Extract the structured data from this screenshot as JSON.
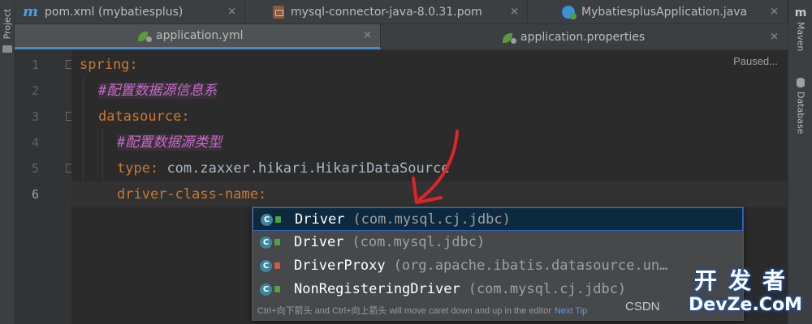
{
  "left_panel": {
    "label": "Project"
  },
  "right_panel": {
    "maven_icon": "m",
    "maven_label": "Maven",
    "database_label": "Database"
  },
  "tabs_top": [
    {
      "label": "pom.xml (mybatiesplus)",
      "icon": "m"
    },
    {
      "label": "mysql-connector-java-8.0.31.pom",
      "icon": "pom-file-icon"
    },
    {
      "label": "MybatiesplusApplication.java",
      "icon": "spring-app-icon"
    }
  ],
  "tabs_files": [
    {
      "label": "application.yml",
      "icon": "yaml-spring-icon"
    },
    {
      "label": "application.properties",
      "icon": "properties-spring-icon"
    }
  ],
  "close_glyph": "✕",
  "editor": {
    "status": "Paused...",
    "lines": [
      {
        "number": "1",
        "key": "spring",
        "colon": ":",
        "value": "",
        "comment": ""
      },
      {
        "number": "2",
        "key": "",
        "colon": "",
        "value": "",
        "comment": "#配置数据源信息系"
      },
      {
        "number": "3",
        "key": "datasource",
        "colon": ":",
        "value": "",
        "comment": ""
      },
      {
        "number": "4",
        "key": "",
        "colon": "",
        "value": "",
        "comment": "#配置数据源类型"
      },
      {
        "number": "5",
        "key": "type",
        "colon": ":",
        "value": " com.zaxxer.hikari.HikariDataSource",
        "comment": ""
      },
      {
        "number": "6",
        "key": "driver-class-name",
        "colon": ":",
        "value": "",
        "comment": ""
      }
    ]
  },
  "completion": {
    "items": [
      {
        "icon": "C",
        "name": "Driver",
        "package": "(com.mysql.cj.jdbc)",
        "visibility": "public"
      },
      {
        "icon": "C",
        "name": "Driver",
        "package": "(com.mysql.jdbc)",
        "visibility": "public"
      },
      {
        "icon": "C",
        "name": "DriverProxy",
        "package": "(org.apache.ibatis.datasource.un…",
        "visibility": "private"
      },
      {
        "icon": "C",
        "name": "NonRegisteringDriver",
        "package": "(com.mysql.cj.jdbc)",
        "visibility": "public"
      }
    ],
    "hint": "Ctrl+向下箭头 and Ctrl+向上箭头 will move caret down and up in the editor",
    "next_tip": "Next Tip"
  },
  "watermark": {
    "csdn": "CSDN",
    "cn": "开发者",
    "en": "DevZe.CoM"
  },
  "colors": {
    "accent_selection": "#0d293e",
    "keyword": "#cc7832",
    "comment": "#bf6ec0",
    "annotation_arrow": "#e0242a"
  }
}
